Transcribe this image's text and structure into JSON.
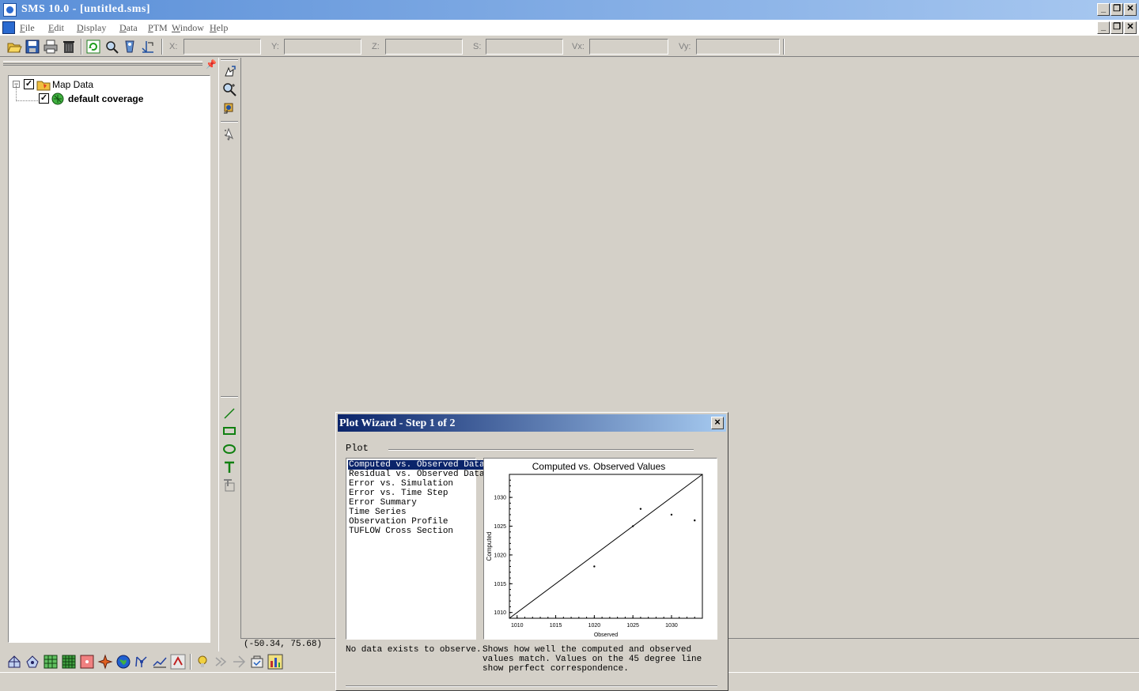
{
  "window": {
    "title": "SMS 10.0 - [untitled.sms]"
  },
  "menu": [
    {
      "label": "File"
    },
    {
      "label": "Edit"
    },
    {
      "label": "Display"
    },
    {
      "label": "Data"
    },
    {
      "label": "PTM"
    },
    {
      "label": "Window"
    },
    {
      "label": "Help"
    }
  ],
  "toolbar": {
    "coords": [
      {
        "label": "X:",
        "value": ""
      },
      {
        "label": "Y:",
        "value": ""
      },
      {
        "label": "Z:",
        "value": ""
      },
      {
        "label": "S:",
        "value": ""
      },
      {
        "label": "Vx:",
        "value": ""
      },
      {
        "label": "Vy:",
        "value": ""
      }
    ]
  },
  "tree": {
    "root_label": "Map Data",
    "child_label": "default coverage"
  },
  "status": {
    "coords": "(-50.34, 75.68)"
  },
  "dialog": {
    "title": "Plot Wizard - Step 1 of 2",
    "group_label": "Plot",
    "plot_types": [
      "Computed vs. Observed Data",
      "Residual vs. Observed Data",
      "Error vs. Simulation",
      "Error vs. Time Step",
      "Error Summary",
      "Time Series",
      "Observation Profile",
      "TUFLOW Cross Section"
    ],
    "selected_index": 0,
    "message_left": "No data exists to observe.",
    "message_right": "Shows how well the computed and observed values match. Values on the 45 degree line show perfect correspondence."
  },
  "chart_data": {
    "type": "scatter",
    "title": "Computed vs. Observed Values",
    "xlabel": "Observed",
    "ylabel": "Computed",
    "xlim": [
      1009,
      1034
    ],
    "ylim": [
      1009,
      1034
    ],
    "xticks": [
      1010,
      1015,
      1020,
      1025,
      1030
    ],
    "yticks": [
      1010,
      1015,
      1020,
      1025,
      1030
    ],
    "reference_line": [
      [
        1009,
        1009
      ],
      [
        1034,
        1034
      ]
    ],
    "points": [
      {
        "x": 1020,
        "y": 1018
      },
      {
        "x": 1025,
        "y": 1025
      },
      {
        "x": 1026,
        "y": 1028
      },
      {
        "x": 1030,
        "y": 1027
      },
      {
        "x": 1033,
        "y": 1026
      }
    ]
  }
}
